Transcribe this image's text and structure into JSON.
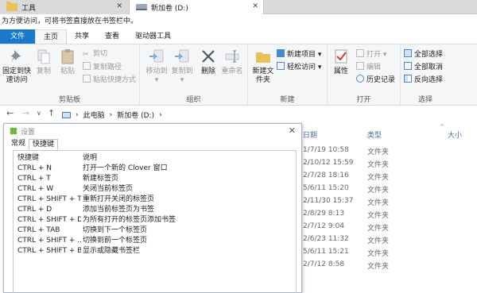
{
  "tabs": [
    {
      "label": "工具",
      "icon": "folder-icon"
    },
    {
      "label": "新加卷 (D:)",
      "icon": "drive-icon"
    }
  ],
  "bookmark_bar": {
    "text": "为方便访问，可将书签直接放在书签栏中。"
  },
  "ribbon_tabs": [
    "文件",
    "主页",
    "共享",
    "查看",
    "驱动器工具"
  ],
  "ribbon": {
    "clipboard": {
      "label": "剪贴板",
      "pin": "固定到快速访问",
      "copy": "复制",
      "paste": "粘贴",
      "cut": "剪切",
      "copy_path": "复制路径",
      "paste_shortcut": "粘贴快捷方式"
    },
    "organize": {
      "label": "组织",
      "move_to": "移动到",
      "copy_to": "复制到",
      "delete": "删除",
      "rename": "重命名"
    },
    "new": {
      "label": "新建",
      "new_folder": "新建文件夹",
      "new_item": "新建项目",
      "easy_access": "轻松访问"
    },
    "open": {
      "label": "打开",
      "properties": "属性",
      "open": "打开",
      "edit": "编辑",
      "history": "历史记录"
    },
    "select": {
      "label": "选择",
      "select_all": "全部选择",
      "select_none": "全部取消",
      "invert": "反向选择"
    }
  },
  "address": {
    "back": "←",
    "forward": "→",
    "dropdown": "∨",
    "up": "↑",
    "crumbs": [
      "›",
      "此电脑",
      "›",
      "新加卷 (D:)",
      "›"
    ]
  },
  "file_list": {
    "columns": {
      "date": "日期",
      "type": "类型",
      "size": "大小",
      "sort_indicator": "^"
    },
    "rows": [
      {
        "date": "1/7/19 10:58",
        "type": "文件夹"
      },
      {
        "date": "2/10/12 15:59",
        "type": "文件夹"
      },
      {
        "date": "2/7/28 18:16",
        "type": "文件夹"
      },
      {
        "date": "5/6/11 15:20",
        "type": "文件夹"
      },
      {
        "date": "2/11/30 15:37",
        "type": "文件夹"
      },
      {
        "date": "2/8/29 8:13",
        "type": "文件夹"
      },
      {
        "date": "2/7/12 9:04",
        "type": "文件夹"
      },
      {
        "date": "2/6/23 11:32",
        "type": "文件夹"
      },
      {
        "date": "5/6/11 15:21",
        "type": "文件夹"
      },
      {
        "date": "2/7/12 8:58",
        "type": "文件夹"
      }
    ]
  },
  "dialog": {
    "title": "设置",
    "close": "✕",
    "tabs": [
      "常规",
      "快捷键"
    ],
    "header": {
      "key": "快捷键",
      "desc": "说明"
    },
    "hotkeys": [
      {
        "key": "CTRL + N",
        "desc": "打开一个新的 Clover 窗口"
      },
      {
        "key": "CTRL + T",
        "desc": "新建标签页"
      },
      {
        "key": "CTRL + W",
        "desc": "关闭当前标签页"
      },
      {
        "key": "CTRL + SHIFT + T",
        "desc": "重新打开关闭的标签页"
      },
      {
        "key": "CTRL + D",
        "desc": "添加当前标签页为书签"
      },
      {
        "key": "CTRL + SHIFT + D",
        "desc": "为所有打开的标签页添加书签"
      },
      {
        "key": "CTRL + TAB",
        "desc": "切换到下一个标签页"
      },
      {
        "key": "CTRL + SHIFT + ...",
        "desc": "切换到前一个标签页"
      },
      {
        "key": "CTRL + SHIFT + B",
        "desc": "显示或隐藏书签栏"
      }
    ]
  }
}
